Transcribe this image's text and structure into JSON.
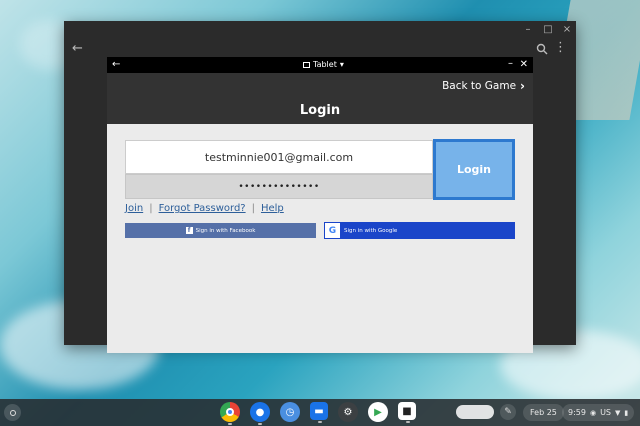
{
  "outer_window": {
    "controls": {
      "minimize": "–",
      "maximize": "□",
      "close": "×"
    },
    "back_icon": "arrow-left-icon",
    "search_icon": "search-icon",
    "more_icon": "more-vert-icon"
  },
  "inner_window": {
    "back": "←",
    "resize_label": "Tablet",
    "minimize": "–",
    "close": "✕"
  },
  "game": {
    "back_to_game": "Back to Game",
    "title": "Login",
    "email_value": "testminnie001@gmail.com",
    "password_value": "••••••••••••••",
    "login_button": "Login",
    "links": {
      "join": "Join",
      "forgot": "Forgot Password?",
      "help": "Help"
    },
    "facebook_button": "Sign in with Facebook",
    "google_button": "Sign in with Google"
  },
  "shelf": {
    "date": "Feb 25",
    "time": "9:59",
    "locale": "US",
    "apps": [
      "chrome",
      "messages",
      "clock",
      "files",
      "settings",
      "play-store",
      "camera-app"
    ]
  },
  "colors": {
    "login_accent": "#77b3ea",
    "facebook": "#5570a8",
    "google": "#1a45c9",
    "header": "#333333"
  }
}
